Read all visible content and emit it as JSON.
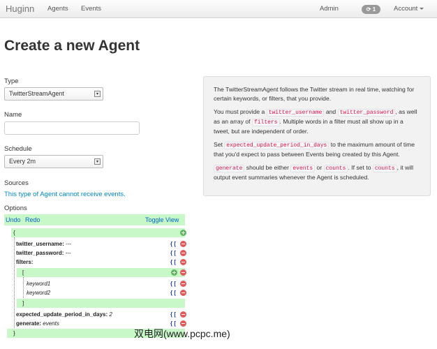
{
  "navbar": {
    "brand": "Huginn",
    "agents": "Agents",
    "events": "Events",
    "admin": "Admin",
    "badge": "1",
    "account": "Account"
  },
  "page_title": "Create a new Agent",
  "form": {
    "type_label": "Type",
    "type_value": "TwitterStreamAgent",
    "name_label": "Name",
    "name_value": "",
    "schedule_label": "Schedule",
    "schedule_value": "Every 2m",
    "sources_label": "Sources",
    "sources_text": "This type of Agent cannot receive events.",
    "options_label": "Options"
  },
  "editor": {
    "undo": "Undo",
    "redo": "Redo",
    "toggle": "Toggle View",
    "open_brace": "{",
    "close_brace": "}",
    "open_bracket": "[",
    "close_bracket": "]",
    "twitter_username_key": "twitter_username:",
    "twitter_username_val": "---",
    "twitter_password_key": "twitter_password:",
    "twitter_password_val": "---",
    "filters_key": "filters:",
    "keyword1": "keyword1",
    "keyword2": "keyword2",
    "period_key": "expected_update_period_in_days:",
    "period_val": "2",
    "generate_key": "generate:",
    "generate_val": "events",
    "type_marker": "{ ["
  },
  "info": {
    "p1": "The TwitterStreamAgent follows the Twitter stream in real time, watching for certain keywords, or filters, that you provide.",
    "p2a": "You must provide a",
    "code_user": "twitter_username",
    "and": "and",
    "code_pass": "twitter_password",
    "p2b": ", as well as an array of",
    "code_filters": "filters",
    "p2c": ". Multiple words in a filter must all show up in a tweet, but are independent of order.",
    "p3a": "Set",
    "code_period": "expected_update_period_in_days",
    "p3b": "to the maximum amount of time that you'd expect to pass between Events being created by this Agent.",
    "code_generate": "generate",
    "p4a": "should be either",
    "code_events": "events",
    "or": "or",
    "code_counts": "counts",
    "p4b": ". If set to",
    "code_counts2": "counts",
    "p4c": ", it will output event summaries whenever the Agent is scheduled."
  },
  "watermark": "双电网(www.pcpc.me)"
}
